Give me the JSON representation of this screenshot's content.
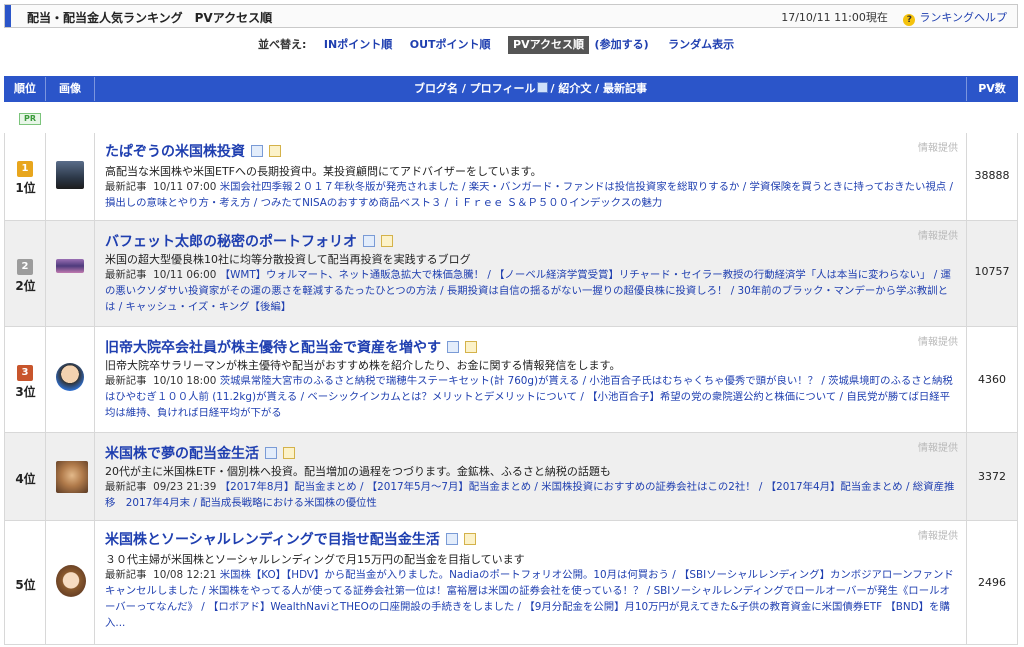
{
  "header": {
    "title": "配当・配当金人気ランキング　PVアクセス順",
    "timestamp": "17/10/11 11:00現在",
    "help_icon": "question-icon",
    "help_label": "ランキングヘルプ",
    "accent_color": "#2b55c9"
  },
  "sort": {
    "label": "並べ替え:",
    "options": [
      "INポイント順",
      "OUTポイント順"
    ],
    "active": "PVアクセス順",
    "join": "(参加する)",
    "random": "ランダム表示"
  },
  "table": {
    "headers": {
      "rank": "順位",
      "image": "画像",
      "blog": "ブログ名 / プロフィール",
      "blog_suffix": "/ 紹介文 / 最新記事",
      "pv": "PV数"
    },
    "pr_badge": "PR",
    "info_label": "情報提供",
    "recent_label": "最新記事"
  },
  "rows": [
    {
      "rank": "1位",
      "medal": "1",
      "title": "たぱぞうの米国株投資",
      "desc": "高配当な米国株や米国ETFへの長期投資中。某投資顧問にてアドバイザーをしています。",
      "date": "10/11 07:00",
      "articles": "米国会社四季報２０１７年秋冬版が発売されました / 楽天・バンガード・ファンドは投信投資家を総取りするか / 学資保険を買うときに持っておきたい視点 / 損出しの意味とやり方・考え方 / つみたてNISAのおすすめ商品ベスト３ / ｉＦｒｅｅ Ｓ＆Ｐ５００インデックスの魅力",
      "pv": "38888"
    },
    {
      "rank": "2位",
      "medal": "2",
      "title": "バフェット太郎の秘密のポートフォリオ",
      "desc": "米国の超大型優良株10社に均等分散投資して配当再投資を実践するブログ",
      "date": "10/11 06:00",
      "articles": "【WMT】ウォルマート、ネット通販急拡大で株価急騰！ / 【ノーベル経済学賞受賞】リチャード・セイラー教授の行動経済学「人は本当に変わらない」 / 運の悪いクソダサい投資家がその運の悪さを軽減するたったひとつの方法 / 長期投資は自信の揺るがない一握りの超優良株に投資しろ！ / 30年前のブラック・マンデーから学ぶ教訓とは / キャッシュ・イズ・キング【後編】",
      "pv": "10757"
    },
    {
      "rank": "3位",
      "medal": "3",
      "title": "旧帝大院卒会社員が株主優待と配当金で資産を増やす",
      "desc": "旧帝大院卒サラリーマンが株主優待や配当がおすすめ株を紹介したり、お金に関する情報発信をします。",
      "date": "10/10 18:00",
      "articles": "茨城県常陸大宮市のふるさと納税で瑞穂牛ステーキセット(計 760g)が貰える / 小池百合子氏はむちゃくちゃ優秀で頭が良い！？ / 茨城県境町のふるさと納税はひやむぎ１００人前 (11.2kg)が貰える / ベーシックインカムとは？メリットとデメリットについて / 【小池百合子】希望の党の衆院選公約と株価について / 自民党が勝てば日経平均は維持、負ければ日経平均が下がる",
      "pv": "4360"
    },
    {
      "rank": "4位",
      "medal": "",
      "title": "米国株で夢の配当金生活",
      "desc": "20代が主に米国株ETF・個別株へ投資。配当増加の過程をつづります。金鉱株、ふるさと納税の話題も",
      "date": "09/23 21:39",
      "articles": "【2017年8月】配当金まとめ / 【2017年5月〜7月】配当金まとめ / 米国株投資におすすめの証券会社はこの2社！ / 【2017年4月】配当金まとめ / 総資産推移　2017年4月末 / 配当成長戦略における米国株の優位性",
      "pv": "3372"
    },
    {
      "rank": "5位",
      "medal": "",
      "title": "米国株とソーシャルレンディングで目指せ配当金生活",
      "desc": "３０代主婦が米国株とソーシャルレンディングで月15万円の配当金を目指しています",
      "date": "10/08 12:21",
      "articles": "米国株【KO】【HDV】から配当金が入りました。Nadiaのポートフォリオ公開。10月は何買おう / 【SBIソーシャルレンディング】カンボジアローンファンドキャンセルしました / 米国株をやってる人が使ってる証券会社第一位は！富裕層は米国の証券会社を使っている！？ / SBIソーシャルレンディングでロールオーバーが発生《ロールオーバーってなんだ》 / 【ロボアド】WealthNaviとTHEOの口座開設の手続きをしました / 【9月分配金を公開】月10万円が見えてきた&子供の教育資金に米国債券ETF 【BND】を購入...",
      "pv": "2496"
    }
  ]
}
